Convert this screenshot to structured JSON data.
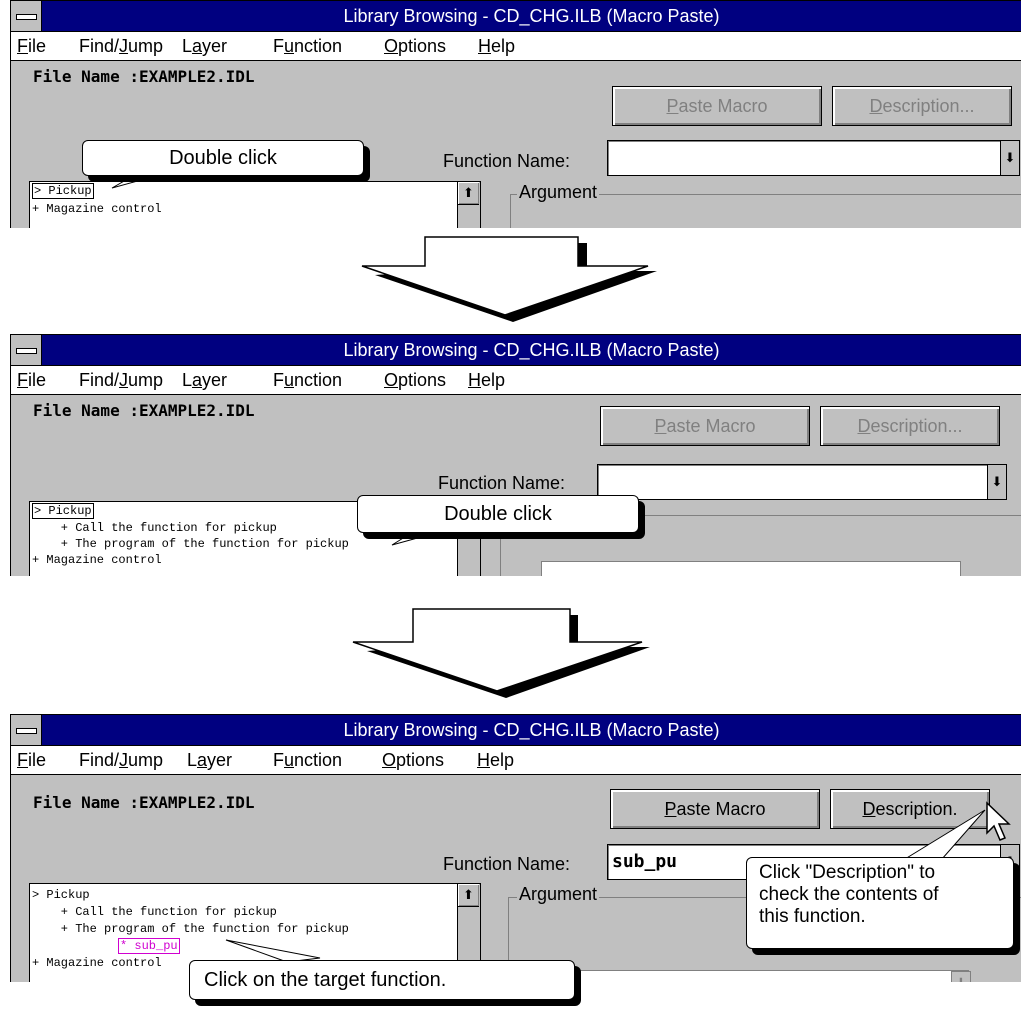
{
  "window": {
    "title": "Library Browsing - CD_CHG.ILB (Macro Paste)",
    "menu": [
      {
        "pre": "",
        "key": "F",
        "post": "ile"
      },
      {
        "pre": "Find/",
        "key": "J",
        "post": "ump"
      },
      {
        "pre": "L",
        "key": "a",
        "post": "yer"
      },
      {
        "pre": "F",
        "key": "u",
        "post": "nction"
      },
      {
        "pre": "",
        "key": "O",
        "post": "ptions"
      },
      {
        "pre": "",
        "key": "H",
        "post": "elp"
      }
    ],
    "file_name_label": "File Name :EXAMPLE2.IDL",
    "paste_macro": {
      "key": "P",
      "rest": "aste Macro"
    },
    "description_disabled": {
      "key": "D",
      "rest": "escription..."
    },
    "description_active": {
      "key": "D",
      "rest": "escription."
    },
    "function_name_label": "Function Name:",
    "argument_label": "Argument",
    "function_name_value": "sub_pu"
  },
  "step1": {
    "tree": [
      "Pickup",
      "+ Magazine control"
    ],
    "callout": "Double click"
  },
  "step2": {
    "tree": [
      "Pickup",
      "    + Call the function for pickup",
      "    + The program of the function for pickup",
      "+ Magazine control"
    ],
    "callout": "Double click"
  },
  "step3": {
    "tree": [
      "Pickup",
      "    + Call the function for pickup",
      "    + The program of the function for pickup",
      "* sub_pu",
      "+ Magazine control"
    ],
    "callout_click": "Click on the target function.",
    "callout_desc": [
      "Click \"Description\" to",
      "check the contents of",
      "this function."
    ]
  },
  "colors": {
    "titlebar": "#000080",
    "window": "#c0c0c0",
    "selected_item": "#d000d0"
  }
}
